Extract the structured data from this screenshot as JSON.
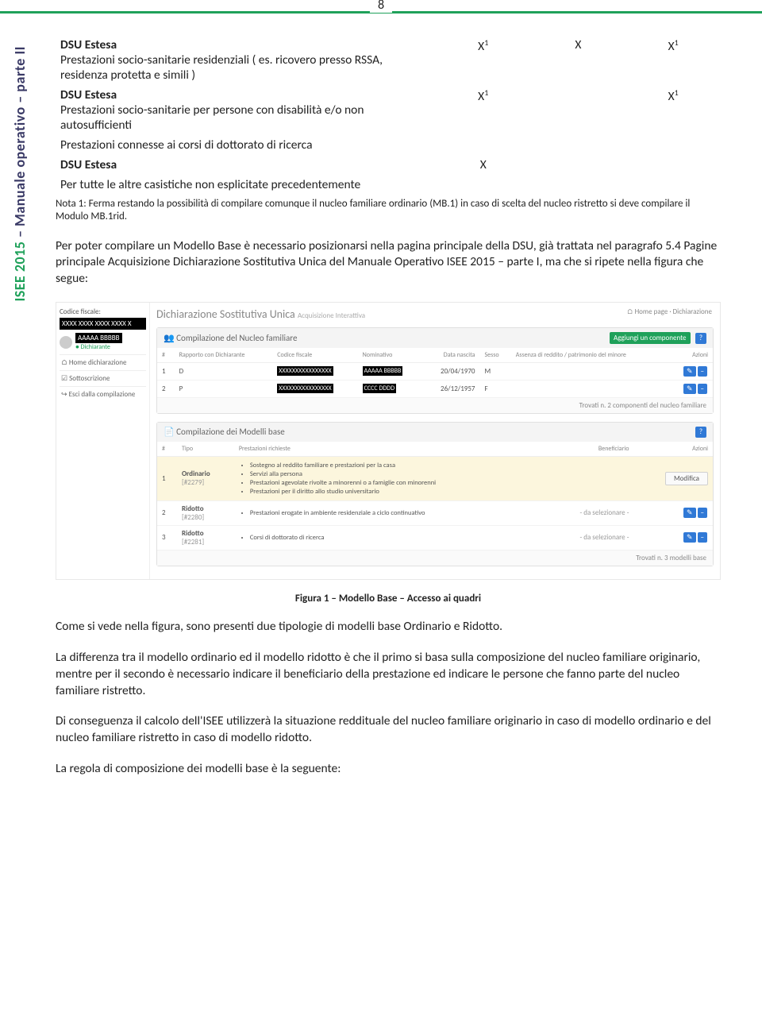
{
  "page_number": "8",
  "side_label_a": "ISEE 2015",
  "side_label_b": " – Manuale operativo – parte II",
  "table_rows": {
    "r1": {
      "title_a": "DSU Estesa",
      "desc": "Prestazioni socio-sanitarie residenziali ( es. ricovero presso RSSA, residenza protetta e simili )",
      "c1": "X",
      "s1": "1",
      "c2": "X",
      "c3": "X",
      "s3": "1"
    },
    "r2": {
      "title_a": "DSU Estesa",
      "desc": "Prestazioni socio-sanitarie per persone con disabilità e/o non autosufficienti",
      "c1": "X",
      "s1": "1",
      "c2": "",
      "c3": "X",
      "s3": "1"
    },
    "r3": {
      "desc": "Prestazioni connesse ai corsi di dottorato di ricerca"
    },
    "r4": {
      "title_a": "DSU Estesa",
      "c1": "X"
    },
    "r5": {
      "desc": "Per tutte le altre casistiche non esplicitate precedentemente"
    }
  },
  "note": "Nota 1: Ferma restando la possibilità di compilare comunque il nucleo familiare ordinario (MB.1) in caso di scelta del nucleo ristretto si deve compilare il Modulo MB.1rid.",
  "para1": "Per poter compilare un Modello Base è necessario posizionarsi nella pagina principale della DSU, già trattata nel paragrafo 5.4 Pagine principale Acquisizione Dichiarazione Sostitutiva Unica del Manuale Operativo ISEE 2015 – parte I, ma che si ripete nella figura che segue:",
  "figure": {
    "codice_label": "Codice fiscale:",
    "codice_val": "XXXX XXXX XXXX XXXX X",
    "av_name": "AAAAA BBBBB",
    "av_role": "● Dichiarante",
    "nav": {
      "a": "⌂  Home dichiarazione",
      "b": "☑  Sottoscrizione",
      "c": "↪  Esci dalla compilazione"
    },
    "title": "Dichiarazione Sostitutiva Unica",
    "title_sub": "Acquisizione Interattiva",
    "breadcrumb": "⌂ Home page  ·  Dichiarazione",
    "panel1": {
      "head": "👥  Compilazione del Nucleo familiare",
      "add": "Aggiungi un componente",
      "th": {
        "n": "#",
        "rap": "Rapporto con Dichiarante",
        "cf": "Codice fiscale",
        "nom": "Nominativo",
        "dn": "Data nascita",
        "sex": "Sesso",
        "ass": "Assenza di reddito / patrimonio del minore",
        "az": "Azioni"
      },
      "rows": [
        {
          "n": "1",
          "rap": "D",
          "cf": "XXXXXXXXXXXXXXXX",
          "nom": "AAAAA BBBBB",
          "dn": "20/04/1970",
          "sex": "M"
        },
        {
          "n": "2",
          "rap": "P",
          "cf": "XXXXXXXXXXXXXXXX",
          "nom": "CCCC DDDD",
          "dn": "26/12/1957",
          "sex": "F"
        }
      ],
      "foot": "Trovati n. 2 componenti del nucleo familiare"
    },
    "panel2": {
      "head": "📄  Compilazione dei Modelli base",
      "th": {
        "n": "#",
        "tipo": "Tipo",
        "prest": "Prestazioni richieste",
        "ben": "Beneficiario",
        "az": "Azioni"
      },
      "rows": [
        {
          "n": "1",
          "tipo": "Ordinario",
          "code": "[#2279]",
          "prest": [
            "Sostegno al reddito familiare e prestazioni per la casa",
            "Servizi alla persona",
            "Prestazioni agevolate rivolte a minorenni o a famiglie con minorenni",
            "Prestazioni per il diritto allo studio universitario"
          ],
          "ben_btn": "Modifica"
        },
        {
          "n": "2",
          "tipo": "Ridotto",
          "code": "[#2280]",
          "prest": [
            "Prestazioni erogate in ambiente residenziale a ciclo continuativo"
          ],
          "ben": "- da selezionare -"
        },
        {
          "n": "3",
          "tipo": "Ridotto",
          "code": "[#2281]",
          "prest": [
            "Corsi di dottorato di ricerca"
          ],
          "ben": "- da selezionare -"
        }
      ],
      "foot": "Trovati n. 3 modelli base"
    }
  },
  "figcaption": "Figura 1 – Modello Base – Accesso ai quadri",
  "para2": "Come si vede nella figura, sono presenti due tipologie di modelli base Ordinario e Ridotto.",
  "para3": "La differenza tra il modello ordinario ed il modello ridotto è che il primo si basa sulla composizione del nucleo familiare originario, mentre per il secondo è necessario indicare il beneficiario della prestazione ed indicare le persone che fanno parte del nucleo familiare ristretto.",
  "para4": "Di conseguenza il calcolo dell'ISEE utilizzerà la situazione reddituale del nucleo familiare originario in caso di modello ordinario e del nucleo familiare ristretto in caso di modello ridotto.",
  "para5": "La regola di composizione dei modelli base è la seguente:"
}
